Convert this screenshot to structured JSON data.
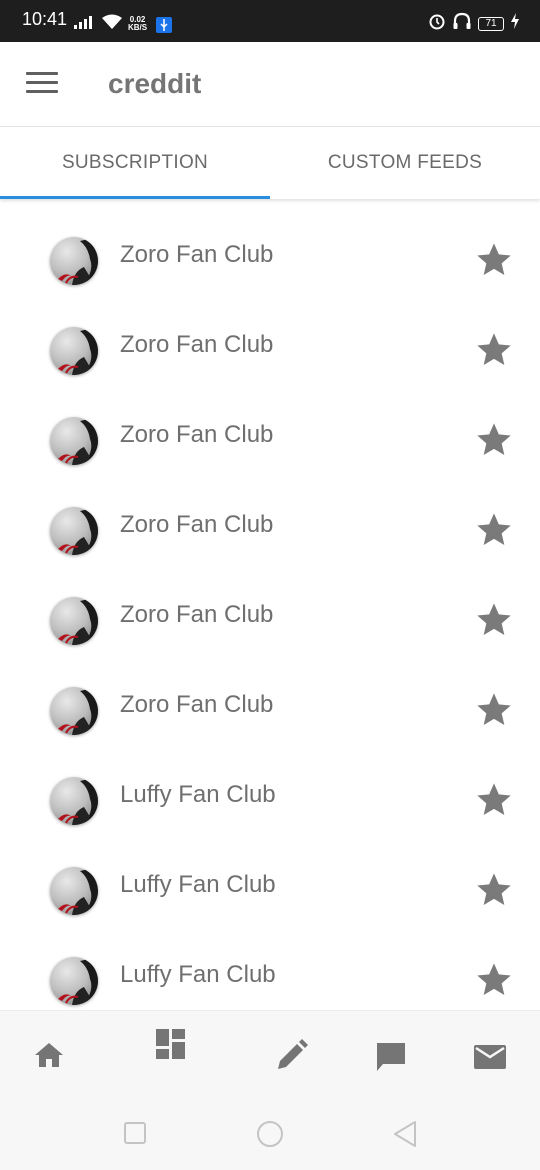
{
  "status_bar": {
    "time": "10:41",
    "speed_value": "0.02",
    "speed_unit": "KB/S",
    "battery": "71"
  },
  "app_bar": {
    "menu_icon": "hamburger-menu-icon",
    "title": "creddit"
  },
  "tabs": [
    {
      "label": "SUBSCRIPTION",
      "active": true
    },
    {
      "label": "CUSTOM FEEDS",
      "active": false
    }
  ],
  "subscriptions": [
    {
      "name": "Zoro Fan Club"
    },
    {
      "name": "Zoro Fan Club"
    },
    {
      "name": "Zoro Fan Club"
    },
    {
      "name": "Zoro Fan Club"
    },
    {
      "name": "Zoro Fan Club"
    },
    {
      "name": "Zoro Fan Club"
    },
    {
      "name": "Luffy Fan Club"
    },
    {
      "name": "Luffy Fan Club"
    },
    {
      "name": "Luffy Fan Club"
    }
  ],
  "bottom_nav": [
    "home-icon",
    "dashboard-icon",
    "edit-icon",
    "chat-icon",
    "mail-icon"
  ],
  "colors": {
    "accent": "#2a8ee0",
    "text": "#6f6f6f",
    "icon": "#7a7a7a",
    "status_bar": "#1e1e1e"
  }
}
